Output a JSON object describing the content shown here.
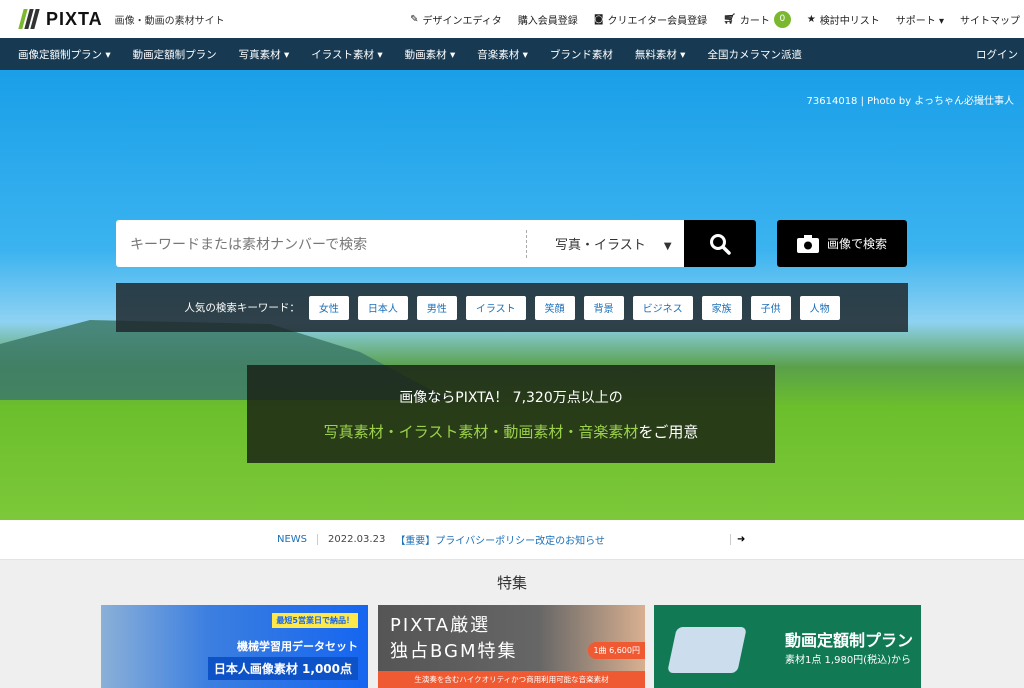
{
  "header": {
    "logo": "PIXTA",
    "tagline": "画像・動画の素材サイト",
    "links": [
      {
        "label": "デザインエディタ",
        "icon": "edit-icon"
      },
      {
        "label": "購入会員登録"
      },
      {
        "label": "クリエイター会員登録",
        "icon": "camera-icon"
      },
      {
        "label": "カート",
        "icon": "cart-icon",
        "count": "0"
      },
      {
        "label": "検討中リスト",
        "icon": "star-icon"
      },
      {
        "label": "サポート ▾"
      },
      {
        "label": "サイトマップ"
      }
    ]
  },
  "nav": {
    "items": [
      "画像定額制プラン ▾",
      "動画定額制プラン",
      "写真素材 ▾",
      "イラスト素材 ▾",
      "動画素材 ▾",
      "音楽素材 ▾",
      "ブランド素材",
      "無料素材 ▾",
      "全国カメラマン派遣"
    ],
    "login": "ログイン"
  },
  "hero": {
    "credit": "73614018 | Photo by よっちゃん必撮仕事人",
    "search_placeholder": "キーワードまたは素材ナンバーで検索",
    "category": "写真・イラスト",
    "image_search": "画像で検索",
    "keywords_label": "人気の検索キーワード：",
    "keywords": [
      "女性",
      "日本人",
      "男性",
      "イラスト",
      "笑顔",
      "背景",
      "ビジネス",
      "家族",
      "子供",
      "人物"
    ],
    "msg_line1": "画像ならPIXTA！ 7,320万点以上の",
    "msg_parts": [
      "写真素材",
      "・",
      "イラスト素材",
      "・",
      "動画素材",
      "・",
      "音楽素材",
      "をご用意"
    ]
  },
  "news": {
    "label": "NEWS",
    "date": "2022.03.23",
    "text": "【重要】プライバシーポリシー改定のお知らせ"
  },
  "features": {
    "title": "特集",
    "banners": [
      {
        "badge": "最短5営業日で納品！",
        "line1": "機械学習用データセット",
        "line2": "日本人画像素材 1,000点"
      },
      {
        "line1": "PIXTA厳選",
        "line2": "独占BGM特集",
        "price": "1曲 6,600円",
        "caption": "生演奏を含むハイクオリティかつ商用利用可能な音楽素材"
      },
      {
        "line1": "動画定額制プラン",
        "line2": "素材1点 1,980円(税込)から"
      }
    ]
  }
}
